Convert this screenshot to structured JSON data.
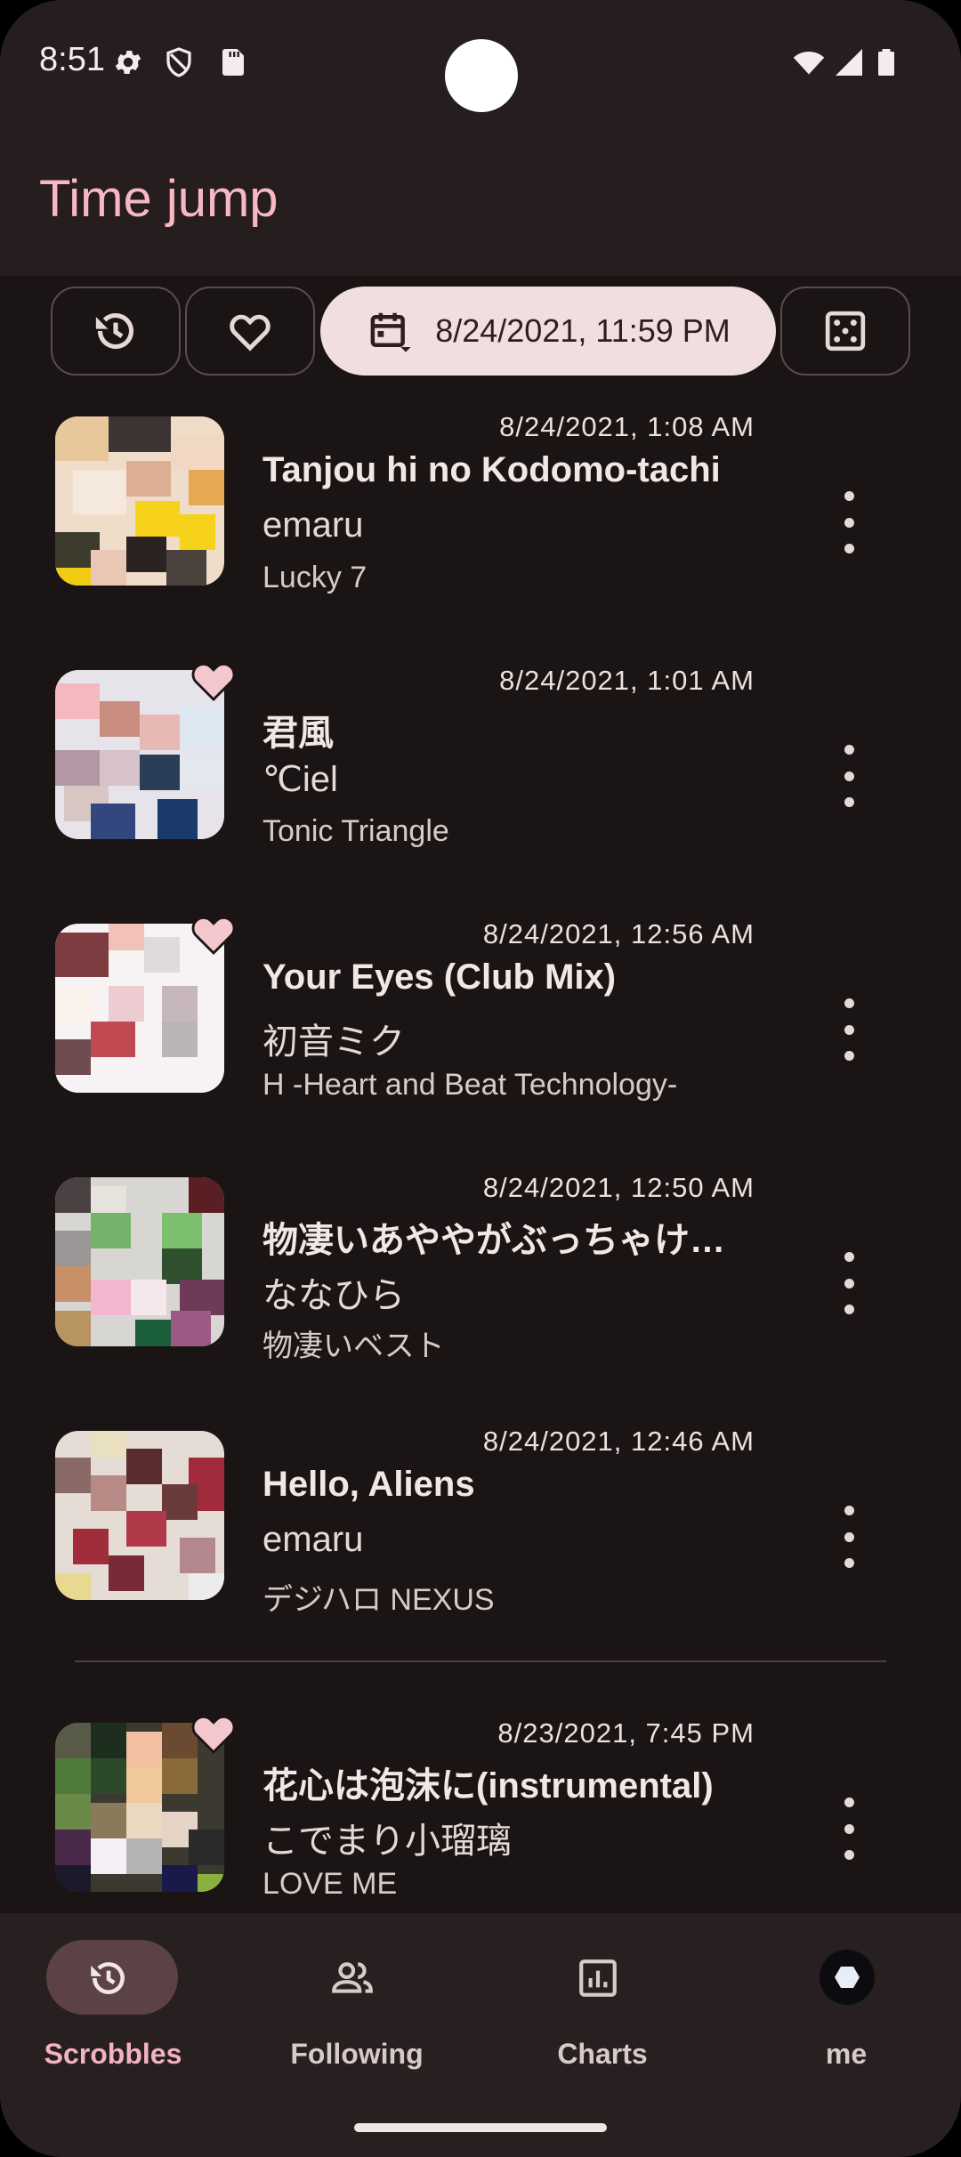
{
  "status_bar": {
    "time": "8:51"
  },
  "app_bar": {
    "title": "Time jump"
  },
  "filters": {
    "date_label": "8/24/2021, 11:59 PM"
  },
  "tracks": [
    {
      "timestamp": "8/24/2021, 1:08 AM",
      "title": "Tanjou hi no Kodomo-tachi",
      "artist": "emaru",
      "album": "Lucky 7",
      "loved": false
    },
    {
      "timestamp": "8/24/2021, 1:01 AM",
      "title": "君風",
      "artist": "℃iel",
      "album": "Tonic Triangle",
      "loved": true
    },
    {
      "timestamp": "8/24/2021, 12:56 AM",
      "title": "Your Eyes (Club Mix)",
      "artist": "初音ミク",
      "album": "H -Heart and Beat Technology-",
      "loved": true
    },
    {
      "timestamp": "8/24/2021, 12:50 AM",
      "title": "物凄いあややがぶっちゃけ…",
      "artist": "ななひら",
      "album": "物凄いベスト",
      "loved": false
    },
    {
      "timestamp": "8/24/2021, 12:46 AM",
      "title": "Hello, Aliens",
      "artist": "emaru",
      "album": "デジハロ NEXUS",
      "loved": false
    },
    {
      "timestamp": "8/23/2021, 7:45 PM",
      "title": "花心は泡沫に(instrumental)",
      "artist": "こでまり小瑠璃",
      "album": "LOVE ME",
      "loved": true
    }
  ],
  "nav": {
    "scrobbles": "Scrobbles",
    "following": "Following",
    "charts": "Charts",
    "me": "me"
  },
  "colors": {
    "accent": "#f7b8c4",
    "background": "#1b1415",
    "chip_selected": "#f1dfe0",
    "nav_active": "#5c4245"
  }
}
